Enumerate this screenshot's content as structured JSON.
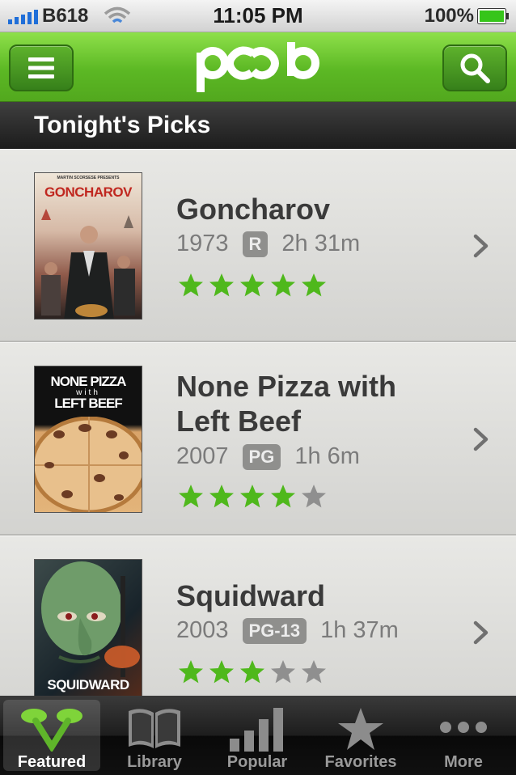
{
  "status_bar": {
    "carrier": "B618",
    "time": "11:05 PM",
    "battery": "100%"
  },
  "nav": {
    "logo_text": "pcob",
    "menu_icon": "menu-icon",
    "search_icon": "search-icon",
    "accent_color": "#5cb824"
  },
  "section": {
    "title": "Tonight's Picks"
  },
  "movies": [
    {
      "title": "Goncharov",
      "year": "1973",
      "rating": "R",
      "duration": "2h 31m",
      "stars": 5,
      "poster_title": "GONCHAROV",
      "poster_credit": "MARTIN SCORSESE PRESENTS"
    },
    {
      "title": "None Pizza with Left Beef",
      "title_line1": "None Pizza with",
      "title_line2": "Left Beef",
      "year": "2007",
      "rating": "PG",
      "duration": "1h 6m",
      "stars": 4,
      "poster_title_line1": "NONE PIZZA",
      "poster_title_line2": "with",
      "poster_title_line3": "LEFT BEEF"
    },
    {
      "title": "Squidward",
      "year": "2003",
      "rating": "PG-13",
      "duration": "1h 37m",
      "stars": 3,
      "poster_title": "SQUIDWARD"
    }
  ],
  "tabs": [
    {
      "label": "Featured",
      "icon": "featured-icon",
      "active": true
    },
    {
      "label": "Library",
      "icon": "book-icon",
      "active": false
    },
    {
      "label": "Popular",
      "icon": "bar-chart-icon",
      "active": false
    },
    {
      "label": "Favorites",
      "icon": "star-icon",
      "active": false
    },
    {
      "label": "More",
      "icon": "more-icon",
      "active": false
    }
  ],
  "colors": {
    "star_filled": "#4fb81c",
    "star_empty": "#8f8f8f"
  }
}
